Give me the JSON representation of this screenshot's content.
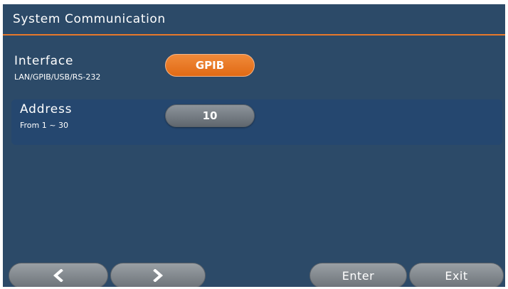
{
  "header": {
    "title": "System Communication"
  },
  "settings": [
    {
      "label": "Interface",
      "sub": "LAN/GPIB/USB/RS-232",
      "value": "GPIB",
      "selected": false
    },
    {
      "label": "Address",
      "sub": "From 1 ~ 30",
      "value": "10",
      "selected": true
    }
  ],
  "footer": {
    "prev_icon": "chevron-left-icon",
    "next_icon": "chevron-right-icon",
    "enter_label": "Enter",
    "exit_label": "Exit"
  },
  "colors": {
    "background": "#2c4a68",
    "accent": "#e8782a",
    "selected_row": "#25476f"
  }
}
